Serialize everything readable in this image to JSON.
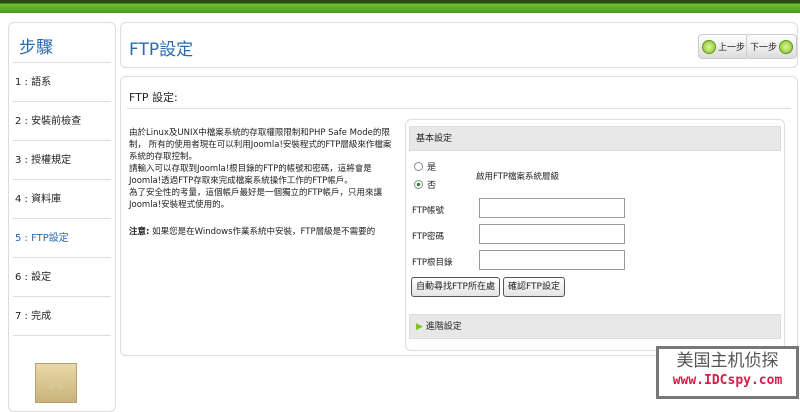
{
  "sidebar": {
    "title": "步驟",
    "steps": [
      "1 : 語系",
      "2 : 安裝前檢查",
      "3 : 授權規定",
      "4 : 資料庫",
      "5 : FTP設定",
      "6 : 設定",
      "7 : 完成"
    ],
    "active_index": 4
  },
  "header": {
    "title": "FTP設定",
    "prev_label": "上一步",
    "next_label": "下一步"
  },
  "main": {
    "section_title": "FTP 設定:",
    "description": "由於Linux及UNIX中檔案系統的存取權限限制和PHP Safe Mode的限制， 所有的使用者現在可以利用Joomla!安裝程式的FTP層級來作檔案系統的存取控制。\n請輸入可以存取到Joomla!根目錄的FTP的帳號和密碼，這將會是Joomla!透過FTP存取來完成檔案系統操作工作的FTP帳戶。\n為了安全性的考量，這個帳戶最好是一個獨立的FTP帳戶，只用來讓Joomla!安裝程式使用的。",
    "note_label": "注意:",
    "note": " 如果您是在Windows作業系統中安裝，FTP層級是不需要的",
    "basic_title": "基本設定",
    "radio_yes": "是",
    "radio_no": "否",
    "radio_selected": "否",
    "enable_label": "啟用FTP檔案系統層級",
    "fields": {
      "user_label": "FTP帳號",
      "user_value": "",
      "pass_label": "FTP密碼",
      "pass_value": "",
      "root_label": "FTP根目錄",
      "root_value": ""
    },
    "auto_find_button": "自動尋找FTP所在處",
    "verify_button": "確認FTP設定",
    "advanced_title": "進階設定"
  },
  "watermark": {
    "line1": "美国主机侦探",
    "line2": "www.IDCspy.com"
  },
  "colors": {
    "accent": "#2a6bb0",
    "topbar": "#5fae2a"
  }
}
